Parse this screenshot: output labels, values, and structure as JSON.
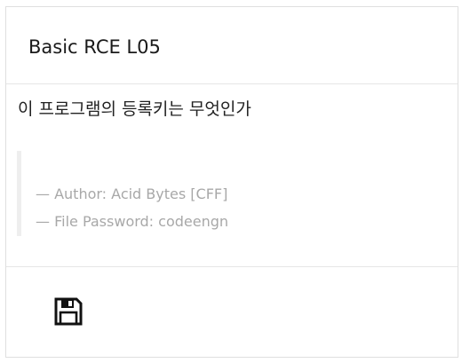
{
  "card": {
    "title": "Basic RCE L05",
    "question": "이 프로그램의 등록키는 무엇인가",
    "quote_lines": [
      "— Author: Acid Bytes [CFF]",
      "— File Password: codeengn"
    ]
  },
  "footer": {
    "save_icon": "floppy-disk-icon"
  },
  "colors": {
    "border": "#dfdfdf",
    "quote_text": "#a8a8a8",
    "quote_bar": "#eeeeee",
    "icon": "#111111"
  }
}
